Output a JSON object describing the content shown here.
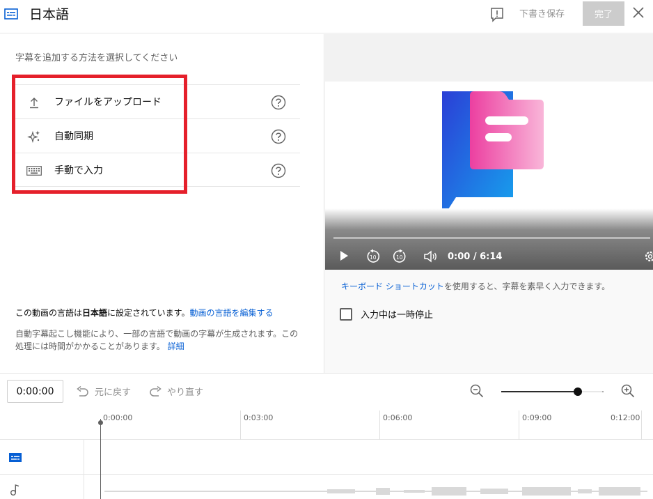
{
  "header": {
    "title": "日本語",
    "save_draft_label": "下書き保存",
    "done_label": "完了"
  },
  "left": {
    "prompt": "字幕を追加する方法を選択してください",
    "methods": [
      {
        "label": "ファイルをアップロード",
        "icon": "upload-icon"
      },
      {
        "label": "自動同期",
        "icon": "sparkle-icon"
      },
      {
        "label": "手動で入力",
        "icon": "keyboard-icon"
      }
    ],
    "language_prefix": "この動画の言語は",
    "language_name": "日本語",
    "language_suffix": "に設定されています。",
    "edit_language_link": "動画の言語を編集する",
    "auto_caption_text": "自動字幕起こし機能により、一部の言語で動画の字幕が生成されます。この処理には時間がかかることがあります。",
    "details_link": "詳細"
  },
  "player": {
    "time": "0:00 / 6:14"
  },
  "right": {
    "keyboard_shortcut_link": "キーボード ショートカット",
    "keyboard_shortcut_text": "を使用すると、字幕を素早く入力できます。",
    "pause_while_typing_label": "入力中は一時停止",
    "pause_while_typing_checked": false
  },
  "timeline": {
    "timecode": "0:00:00",
    "undo_label": "元に戻す",
    "redo_label": "やり直す",
    "zoom_level": 0.77,
    "ticks": [
      "0:00:00",
      "0:03:00",
      "0:06:00",
      "0:09:00",
      "0:12:00"
    ]
  },
  "colors": {
    "link": "#065fd4",
    "highlight": "#e5202b",
    "track_icon": "#065fd4"
  }
}
